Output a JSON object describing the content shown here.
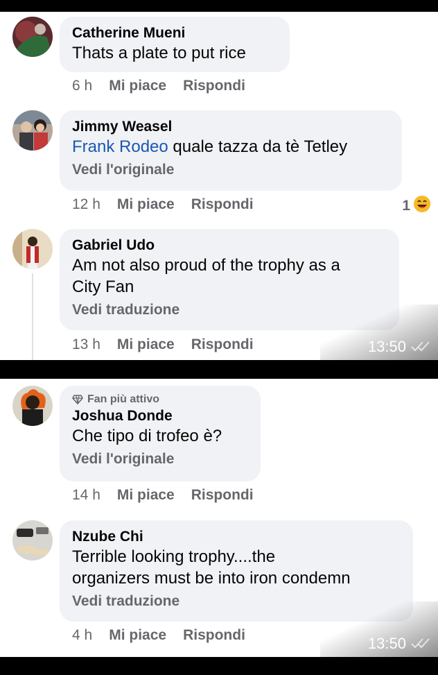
{
  "screenshot1": {
    "comments": [
      {
        "name": "Catherine Mueni",
        "text": "Thats a plate to put rice",
        "time": "6 h",
        "like": "Mi piace",
        "reply": "Rispondi"
      },
      {
        "name": "Jimmy Weasel",
        "mention": "Frank Rodeo",
        "text": "quale tazza da tè Tetley",
        "see": "Vedi l'originale",
        "time": "12 h",
        "like": "Mi piace",
        "reply": "Rispondi",
        "reaction_count": "1",
        "reaction_icon": "laughing-emoji-icon"
      },
      {
        "name": "Gabriel Udo",
        "text_line1": "Am not also proud of the trophy as a",
        "text_line2": "City Fan",
        "see": "Vedi traduzione",
        "time": "13 h",
        "like": "Mi piace",
        "reply": "Rispondi"
      }
    ],
    "timestamp": "13:50"
  },
  "screenshot2": {
    "comments": [
      {
        "badge": "Fan più attivo",
        "badge_icon": "diamond-icon",
        "name": "Joshua Donde",
        "text": "Che tipo di trofeo è?",
        "see": "Vedi l'originale",
        "time": "14 h",
        "like": "Mi piace",
        "reply": "Rispondi"
      },
      {
        "name": "Nzube Chi",
        "text_line1": "Terrible looking trophy....the",
        "text_line2": "organizers must be into iron condemn",
        "see": "Vedi traduzione",
        "time": "4 h",
        "like": "Mi piace",
        "reply": "Rispondi"
      }
    ],
    "timestamp": "13:50"
  },
  "colors": {
    "bubble": "#f0f2f5",
    "mention": "#1b58b3",
    "secondary_text": "#65676b"
  }
}
